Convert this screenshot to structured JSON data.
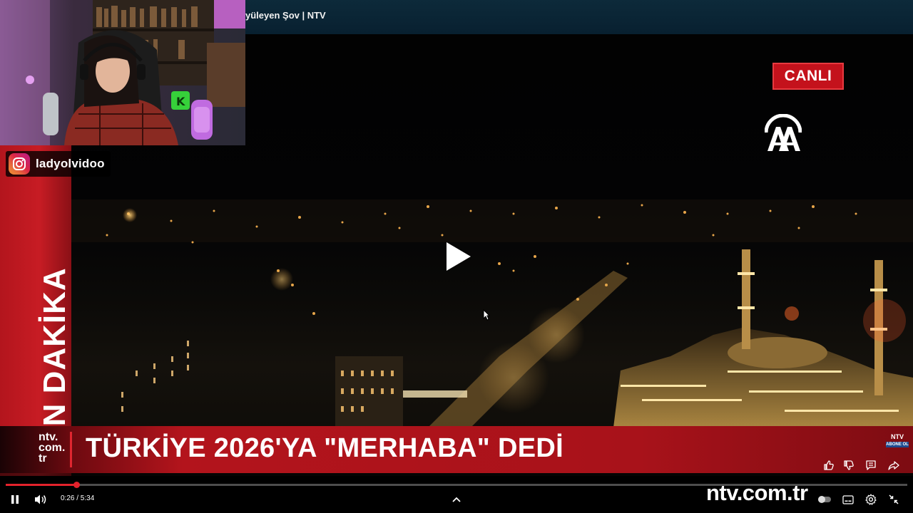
{
  "video": {
    "title": "yüleyen Şov | NTV",
    "instagram_handle": "ladyolvidoo",
    "breaking_band": "SON DAKİKA",
    "live_badge": "CANLI",
    "broadcaster_logo": "aa-logo",
    "headline": "TÜRKİYE 2026'YA \"MERHABA\" DEDİ",
    "channel_small": [
      "ntv.",
      "com.",
      "tr"
    ],
    "corner_logo": "NTV",
    "corner_subscribe": "ABONE OL",
    "watermark": "ntv.com.tr"
  },
  "player": {
    "current_time": "0:26",
    "duration": "5:34",
    "time_display": "0:26 / 5:34",
    "progress_fraction": 0.078,
    "state": "paused",
    "icons": {
      "pause": "pause-icon",
      "volume": "volume-icon",
      "expand": "chevron-up-icon",
      "subtitles": "subtitles-icon",
      "settings": "gear-icon",
      "exit_fullscreen": "exit-fullscreen-icon",
      "like": "thumbs-up-icon",
      "dislike": "thumbs-down-icon",
      "comment": "comment-icon",
      "share": "share-icon",
      "play": "play-icon"
    }
  },
  "colors": {
    "progress": "#e3222c",
    "news_red": "#c4121c",
    "title_bar": "#0b2535"
  }
}
